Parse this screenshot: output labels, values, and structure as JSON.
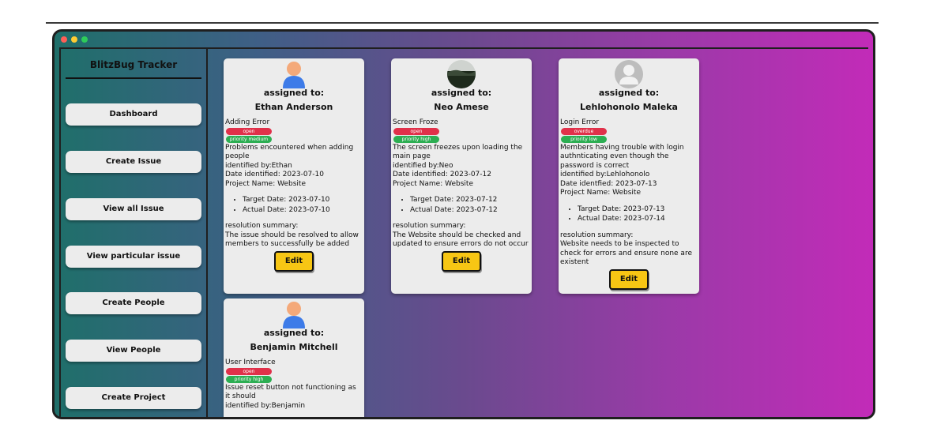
{
  "sidebar": {
    "brand": "BlitzBug Tracker",
    "items": [
      {
        "label": "Dashboard"
      },
      {
        "label": "Create Issue"
      },
      {
        "label": "View all Issue"
      },
      {
        "label": "View particular issue"
      },
      {
        "label": "Create People"
      },
      {
        "label": "View People"
      },
      {
        "label": "Create Project"
      }
    ]
  },
  "cards": [
    {
      "avatar": "person-icon",
      "assigned_label": "assigned to:",
      "name": "Ethan Anderson",
      "title": "Adding Error",
      "status": "open",
      "priority": "priority medium",
      "description": "Problems encountered when adding people",
      "identified_by": "identified by:Ethan",
      "date_identified": "Date identified: 2023-07-10",
      "project": "Project Name: Website",
      "target_date": "Target Date: 2023-07-10",
      "actual_date": "Actual Date: 2023-07-10",
      "resolution_label": "resolution summary:",
      "resolution": "The issue should be resolved to allow members to successfully be added",
      "edit_label": "Edit"
    },
    {
      "avatar": "photo-avatar",
      "assigned_label": "assigned to:",
      "name": "Neo Amese",
      "title": "Screen Froze",
      "status": "open",
      "priority": "priority high",
      "description": "The screen freezes upon loading the main page",
      "identified_by": "identified by:Neo",
      "date_identified": "Date identified: 2023-07-12",
      "project": "Project Name: Website",
      "target_date": "Target Date: 2023-07-12",
      "actual_date": "Actual Date: 2023-07-12",
      "resolution_label": "resolution summary:",
      "resolution": "The Website should be checked and updated to ensure errors do not occur",
      "edit_label": "Edit"
    },
    {
      "avatar": "default-user-icon",
      "assigned_label": "assigned to:",
      "name": "Lehlohonolo Maleka",
      "title": "Login Error",
      "status": "overdue",
      "priority": "priority low",
      "description": "Members having trouble with login authnticating even though the password is correct",
      "identified_by": "identified by:Lehlohonolo",
      "date_identified": "Date identfied: 2023-07-13",
      "project": "Project Name: Website",
      "target_date": "Target Date: 2023-07-13",
      "actual_date": "Actual Date: 2023-07-14",
      "resolution_label": "resolution summary:",
      "resolution": "Website needs to be inspected to check for errors and ensure none are existent",
      "edit_label": "Edit"
    },
    {
      "avatar": "person-icon",
      "assigned_label": "assigned to:",
      "name": "Benjamin Mitchell",
      "title": "User Interface",
      "status": "open",
      "priority": "priority high",
      "description": "Issue reset button not functioning as it should",
      "identified_by": "identified by:Benjamin"
    }
  ],
  "colors": {
    "gradient_start": "#1f6f6a",
    "gradient_end": "#c22bb8",
    "badge_red": "#e0314a",
    "badge_green": "#2cae52",
    "edit_yellow": "#f7c614",
    "scroll_thumb": "#2f6cf0"
  }
}
